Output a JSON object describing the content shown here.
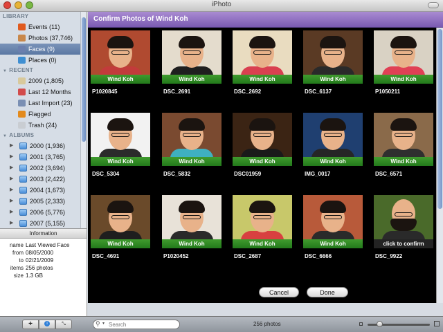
{
  "window": {
    "title": "iPhoto"
  },
  "sidebar": {
    "library_header": "LIBRARY",
    "library": [
      {
        "label": "Events (11)",
        "icon": "events-icon",
        "color": "#e05a1e"
      },
      {
        "label": "Photos (37,746)",
        "icon": "photos-icon",
        "color": "#c8874a"
      },
      {
        "label": "Faces (9)",
        "icon": "faces-icon",
        "color": "#6b7fae",
        "selected": true
      },
      {
        "label": "Places (0)",
        "icon": "places-icon",
        "color": "#3f8fd2"
      }
    ],
    "recent_header": "RECENT",
    "recent": [
      {
        "label": "2009 (1,805)",
        "icon": "event-album-icon",
        "color": "#d8c99c"
      },
      {
        "label": "Last 12 Months",
        "icon": "calendar-icon",
        "color": "#d24b4b"
      },
      {
        "label": "Last Import (23)",
        "icon": "import-icon",
        "color": "#7a8fb3"
      },
      {
        "label": "Flagged",
        "icon": "flag-icon",
        "color": "#e38a1c"
      },
      {
        "label": "Trash (24)",
        "icon": "trash-icon",
        "color": "#c9cdd2"
      }
    ],
    "albums_header": "ALBUMS",
    "albums": [
      {
        "label": "2000 (1,936)"
      },
      {
        "label": "2001 (3,765)"
      },
      {
        "label": "2002 (3,694)"
      },
      {
        "label": "2003 (2,422)"
      },
      {
        "label": "2004 (1,673)"
      },
      {
        "label": "2005 (2,333)"
      },
      {
        "label": "2006 (5,776)"
      },
      {
        "label": "2007 (5,155)"
      }
    ]
  },
  "info": {
    "header": "Information",
    "rows": [
      {
        "key": "name",
        "value": "Last Viewed Face"
      },
      {
        "key": "from",
        "value": "08/05/2000"
      },
      {
        "key": "to",
        "value": "02/21/2009"
      },
      {
        "key": "items",
        "value": "256 photos"
      },
      {
        "key": "size",
        "value": "1.3 GB"
      }
    ]
  },
  "confirm": {
    "title": "Confirm Photos of Wind Koh",
    "accent_color": "#8e6fc4",
    "confirmed_color": "#2e8a22",
    "tiles": [
      {
        "file": "P1020845",
        "label": "Wind Koh",
        "bg": "#b04a30",
        "shirt": "#c23b3b"
      },
      {
        "file": "DSC_2691",
        "label": "Wind Koh",
        "bg": "#e4dccd",
        "shirt": "#1f1f1f"
      },
      {
        "file": "DSC_2692",
        "label": "Wind Koh",
        "bg": "#e9dcc0",
        "shirt": "#d94050"
      },
      {
        "file": "DSC_6137",
        "label": "Wind Koh",
        "bg": "#5a3a24",
        "shirt": "#2a2a2a"
      },
      {
        "file": "P1050211",
        "label": "Wind Koh",
        "bg": "#d9d2c4",
        "shirt": "#e04055"
      },
      {
        "file": "DSC_5304",
        "label": "Wind Koh",
        "bg": "#f2f2f2",
        "shirt": "#2b2b2b"
      },
      {
        "file": "DSC_5832",
        "label": "Wind Koh",
        "bg": "#7a4a30",
        "shirt": "#3fb0c0"
      },
      {
        "file": "DSC01959",
        "label": "Wind Koh",
        "bg": "#3b2414",
        "shirt": "#1a1a1a"
      },
      {
        "file": "IMG_0017",
        "label": "Wind Koh",
        "bg": "#1f3f70",
        "shirt": "#262626"
      },
      {
        "file": "DSC_6571",
        "label": "Wind Koh",
        "bg": "#8a6a4a",
        "shirt": "#2f2f2f"
      },
      {
        "file": "DSC_4691",
        "label": "Wind Koh",
        "bg": "#6a4a2a",
        "shirt": "#1e1e1e"
      },
      {
        "file": "P1020452",
        "label": "Wind Koh",
        "bg": "#e8e2d8",
        "shirt": "#2a2a2a"
      },
      {
        "file": "DSC_2687",
        "label": "Wind Koh",
        "bg": "#c8c86a",
        "shirt": "#d84040"
      },
      {
        "file": "DSC_6666",
        "label": "Wind Koh",
        "bg": "#b85a3a",
        "shirt": "#2a2a2a"
      },
      {
        "file": "DSC_9922",
        "label": "click to confirm",
        "bg": "#4a6a2a",
        "shirt": "#2a2a2a",
        "unconfirmed": true
      }
    ],
    "cancel_label": "Cancel",
    "done_label": "Done"
  },
  "toolbar": {
    "add_label": "+",
    "info_label": "i",
    "fullscreen_label": "⤡",
    "search_placeholder": "Search",
    "photo_count": "256 photos"
  }
}
